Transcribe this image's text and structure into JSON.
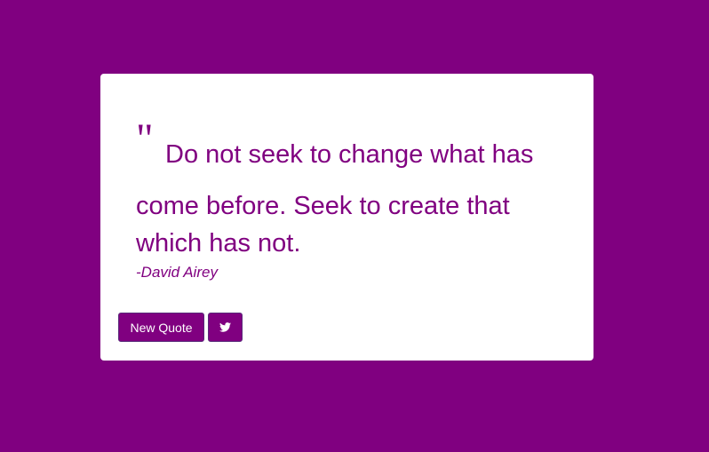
{
  "quote": {
    "mark": "\"",
    "line1": "Do not seek to change what has",
    "line2": "come before. Seek to create that",
    "line3": "which has not.",
    "author": "-David Airey"
  },
  "buttons": {
    "new_quote_label": "New Quote",
    "tweet_icon": "twitter-icon"
  },
  "colors": {
    "background": "#800080",
    "card": "#ffffff",
    "accent": "#800080"
  }
}
